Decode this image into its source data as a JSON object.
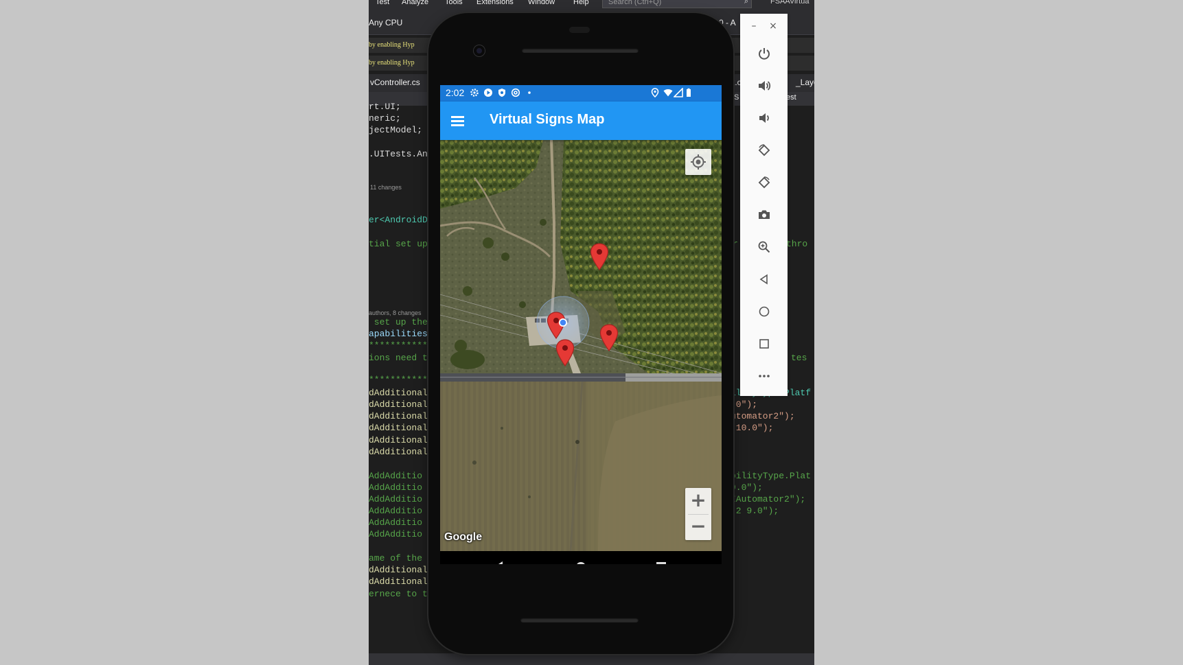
{
  "vs": {
    "menu": [
      "Test",
      "Analyze",
      "Tools",
      "Extensions",
      "Window",
      "Help"
    ],
    "search_placeholder": "Search (Ctrl+Q)",
    "app_name": "FSAAVirtua",
    "config": "Any CPU",
    "toolbar_right": "0 - A",
    "warning_1": "by enabling Hyp",
    "warning_2": "by enabling Hyp",
    "tab_controller": "vController.cs",
    "tab_right_1": "t.c",
    "tab_right_2": "_Layo",
    "breadcrumb_right_1": "S",
    "breadcrumb_right_2": "est",
    "codelens_1": "11 changes",
    "codelens_2": "authors, 8 changes",
    "code_left": [
      {
        "t": "rt.UI;",
        "c": "c-w"
      },
      {
        "t": "neric;",
        "c": "c-w"
      },
      {
        "t": "jectModel;",
        "c": "c-w"
      },
      {
        "t": ".UITests.An",
        "c": "c-w"
      },
      {
        "t": "er<AndroidD",
        "c": "c-t"
      },
      {
        "t": "tial set up",
        "c": "c-g"
      },
      {
        "t": " set up the",
        "c": "c-g"
      },
      {
        "t": "apabilities",
        "c": "c-b"
      },
      {
        "t": "***********",
        "c": "c-g"
      },
      {
        "t": "ions need t",
        "c": "c-g"
      },
      {
        "t": "***********",
        "c": "c-g"
      },
      {
        "t": "dAdditional",
        "c": "c-y"
      },
      {
        "t": "dAdditional",
        "c": "c-y"
      },
      {
        "t": "dAdditional",
        "c": "c-y"
      },
      {
        "t": "dAdditional",
        "c": "c-y"
      },
      {
        "t": "dAdditional",
        "c": "c-y"
      },
      {
        "t": "dAdditional",
        "c": "c-y"
      },
      {
        "t": "AddAdditio",
        "c": "c-g"
      },
      {
        "t": "AddAdditio",
        "c": "c-g"
      },
      {
        "t": "AddAdditio",
        "c": "c-g"
      },
      {
        "t": "AddAdditio",
        "c": "c-g"
      },
      {
        "t": "AddAdditio",
        "c": "c-g"
      },
      {
        "t": "AddAdditio",
        "c": "c-g"
      },
      {
        "t": "ame of the",
        "c": "c-g"
      },
      {
        "t": "dAdditional",
        "c": "c-y"
      },
      {
        "t": "dAdditional",
        "c": "c-y"
      },
      {
        "t": "ernece to the",
        "c": "c-g"
      }
    ],
    "code_right": [
      {
        "t": "r",
        "c": "c-g"
      },
      {
        "t": "thro",
        "c": "c-g"
      },
      {
        "t": "tes",
        "c": "c-g"
      },
      {
        "t": "ilityType.Platf",
        "c": "c-t"
      },
      {
        "t": ".0\");",
        "c": "c-s"
      },
      {
        "t": "utomator2\");",
        "c": "c-s"
      },
      {
        "t": " 10.0\");",
        "c": "c-s"
      },
      {
        "t": "bilityType.Plat",
        "c": "c-g"
      },
      {
        "t": "9.0\");",
        "c": "c-g"
      },
      {
        "t": "IAutomator2\");",
        "c": "c-g"
      },
      {
        "t": " 2 9.0\");",
        "c": "c-g"
      }
    ]
  },
  "android": {
    "status_time": "2:02",
    "app_title": "Virtual Signs Map",
    "map": {
      "attribution": "Google",
      "zoom_in_label": "+",
      "zoom_out_label": "−",
      "markers": 4,
      "marker_color": "#e53935",
      "my_location_color": "#4285f4"
    },
    "appbar_color": "#2196f3",
    "statusbar_color": "#1a78d6"
  },
  "emulator_toolbar": {
    "minimize_label": "–",
    "close_label": "×",
    "buttons": [
      "power-icon",
      "volume-up-icon",
      "volume-down-icon",
      "rotate-left-icon",
      "rotate-right-icon",
      "camera-icon",
      "zoom-icon",
      "back-icon",
      "home-icon",
      "overview-icon",
      "more-icon"
    ]
  }
}
